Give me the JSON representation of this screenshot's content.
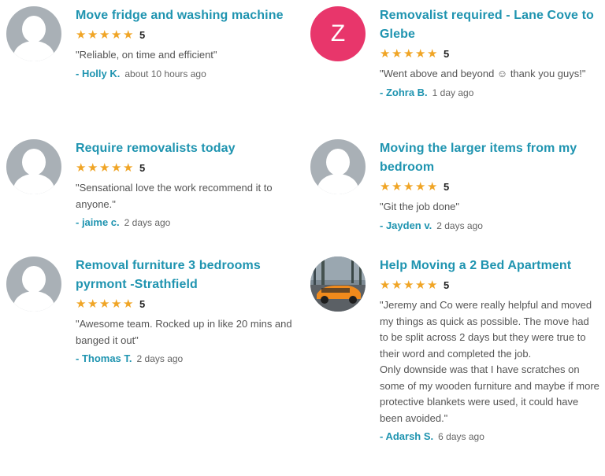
{
  "reviews": [
    {
      "title": "Move fridge and washing machine",
      "stars": 5,
      "score": "5",
      "text": "\"Reliable, on time and efficient\"",
      "author": "- Holly K.",
      "time": "about 10 hours ago",
      "avatar": "default-user-icon"
    },
    {
      "title": "Removalist required - Lane Cove to Glebe",
      "stars": 5,
      "score": "5",
      "text": "\"Went above and beyond ☺ thank you guys!\"",
      "author": "- Zohra B.",
      "time": "1 day ago",
      "avatar_letter": "Z",
      "avatar_color": "#e8366b"
    },
    {
      "title": "Require removalists today",
      "stars": 5,
      "score": "5",
      "text": "\"Sensational love the work recommend it  to anyone.\"",
      "author": "- jaime c.",
      "time": "2 days ago",
      "avatar": "default-user-icon"
    },
    {
      "title": "Moving the larger items from my bedroom",
      "stars": 5,
      "score": "5",
      "text": "\"Git the job done\"",
      "author": "- Jayden v.",
      "time": "2 days ago",
      "avatar": "default-user-icon"
    },
    {
      "title": "Removal furniture 3 bedrooms pyrmont -Strathfield",
      "stars": 5,
      "score": "5",
      "text": "\"Awesome team. Rocked up in like 20 mins and banged it out\"",
      "author": "- Thomas T.",
      "time": "2 days ago",
      "avatar": "default-user-icon"
    },
    {
      "title": "Help Moving a 2 Bed Apartment",
      "stars": 5,
      "score": "5",
      "text": "\"Jeremy and Co were really helpful and moved my things as quick as possible. The move had to be split across 2 days but they were true to their word and completed the job.\nOnly downside was that I have scratches on some of my wooden furniture and maybe if more protective blankets were used, it could have been avoided.\"",
      "author": "- Adarsh S.",
      "time": "6 days ago",
      "avatar": "photo-car-avatar"
    }
  ],
  "colors": {
    "accent": "#1f94b0",
    "star": "#f0a526",
    "letter_avatar": "#e8366b",
    "default_avatar": "#a9b0b6"
  }
}
